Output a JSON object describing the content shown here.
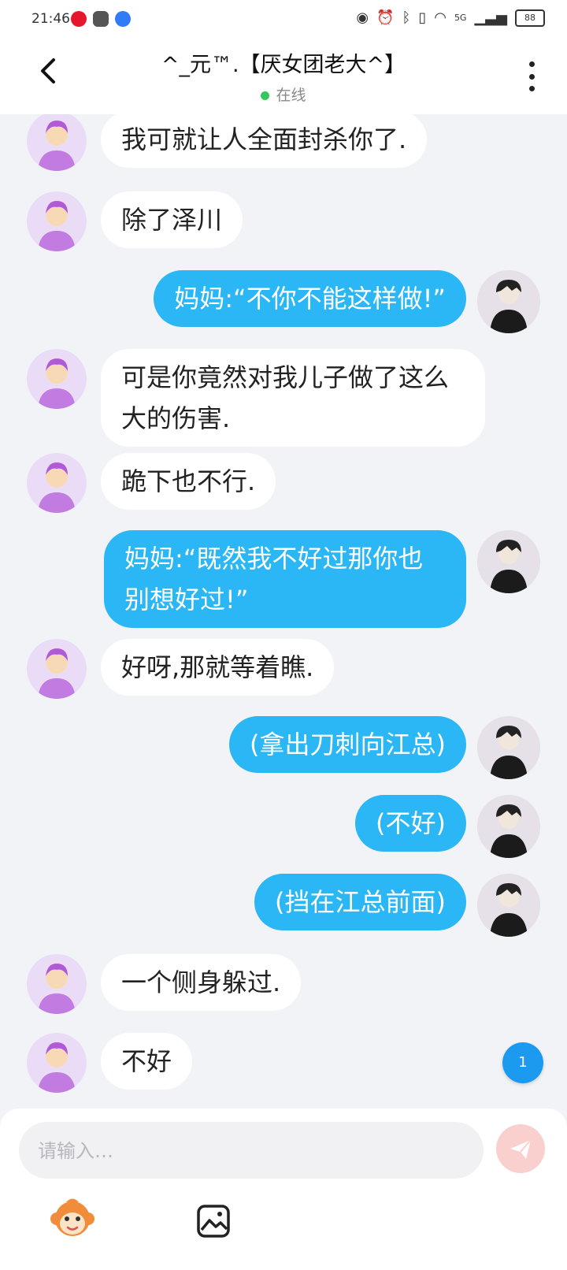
{
  "status_bar": {
    "time": "21:46",
    "network": "5G",
    "battery": "88"
  },
  "header": {
    "title": "^_元™.【厌女团老大^】",
    "status": "在线"
  },
  "messages": [
    {
      "side": "left",
      "text": "我可就让人全面封杀你了."
    },
    {
      "side": "left",
      "text": "除了泽川"
    },
    {
      "side": "right",
      "text": "妈妈:“不你不能这样做!”"
    },
    {
      "side": "left",
      "text": "可是你竟然对我儿子做了这么大的伤害."
    },
    {
      "side": "left",
      "text": "跪下也不行."
    },
    {
      "side": "right",
      "text": "妈妈:“既然我不好过那你也别想好过!”"
    },
    {
      "side": "left",
      "text": "好呀,那就等着瞧."
    },
    {
      "side": "right",
      "text": "(拿出刀刺向江总)"
    },
    {
      "side": "right",
      "text": "(不好)"
    },
    {
      "side": "right",
      "text": "(挡在江总前面)"
    },
    {
      "side": "left",
      "text": "一个侧身躲过."
    },
    {
      "side": "left",
      "text": "不好"
    }
  ],
  "unread_badge": "1",
  "composer": {
    "placeholder": "请输入…"
  },
  "colors": {
    "accent_blue": "#2bb6f5",
    "online_green": "#35c759",
    "send_disabled": "#f9d0cd"
  }
}
